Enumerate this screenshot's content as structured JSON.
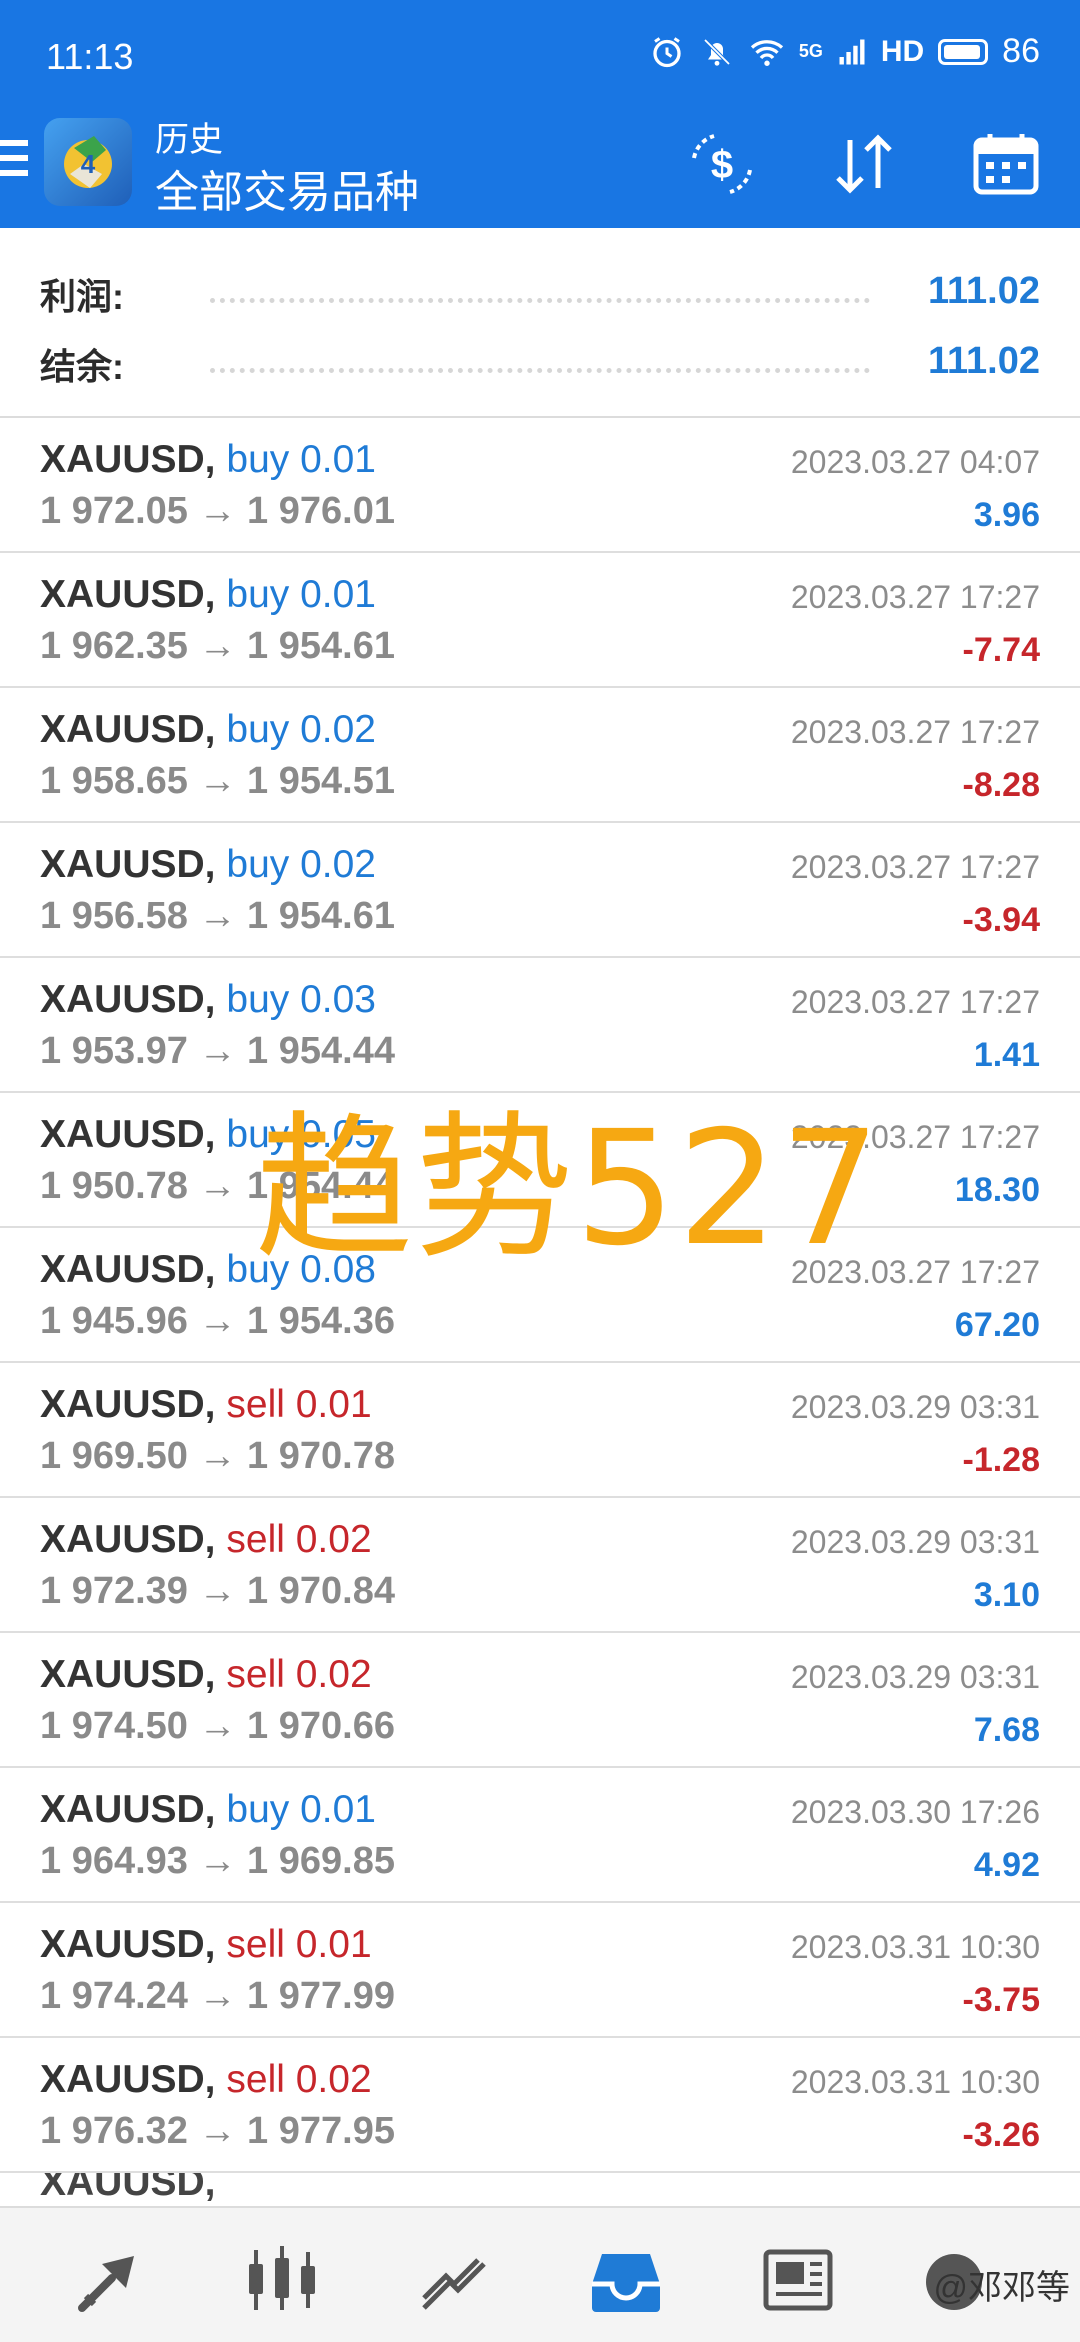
{
  "status": {
    "time": "11:13",
    "network": "5G",
    "hd": "HD",
    "battery": "86"
  },
  "toolbar": {
    "subtitle": "历史",
    "title": "全部交易品种"
  },
  "summary": [
    {
      "label": "利润:",
      "value": "111.02"
    },
    {
      "label": "结余:",
      "value": "111.02"
    }
  ],
  "trades": [
    {
      "symbol": "XAUUSD,",
      "side": "buy",
      "volume": "buy 0.01",
      "open": "1 972.05",
      "close": "1 976.01",
      "time": "2023.03.27 04:07",
      "profit": "3.96"
    },
    {
      "symbol": "XAUUSD,",
      "side": "buy",
      "volume": "buy 0.01",
      "open": "1 962.35",
      "close": "1 954.61",
      "time": "2023.03.27 17:27",
      "profit": "-7.74"
    },
    {
      "symbol": "XAUUSD,",
      "side": "buy",
      "volume": "buy 0.02",
      "open": "1 958.65",
      "close": "1 954.51",
      "time": "2023.03.27 17:27",
      "profit": "-8.28"
    },
    {
      "symbol": "XAUUSD,",
      "side": "buy",
      "volume": "buy 0.02",
      "open": "1 956.58",
      "close": "1 954.61",
      "time": "2023.03.27 17:27",
      "profit": "-3.94"
    },
    {
      "symbol": "XAUUSD,",
      "side": "buy",
      "volume": "buy 0.03",
      "open": "1 953.97",
      "close": "1 954.44",
      "time": "2023.03.27 17:27",
      "profit": "1.41"
    },
    {
      "symbol": "XAUUSD,",
      "side": "buy",
      "volume": "buy 0.05",
      "open": "1 950.78",
      "close": "1 954.44",
      "time": "2023.03.27 17:27",
      "profit": "18.30"
    },
    {
      "symbol": "XAUUSD,",
      "side": "buy",
      "volume": "buy 0.08",
      "open": "1 945.96",
      "close": "1 954.36",
      "time": "2023.03.27 17:27",
      "profit": "67.20"
    },
    {
      "symbol": "XAUUSD,",
      "side": "sell",
      "volume": "sell 0.01",
      "open": "1 969.50",
      "close": "1 970.78",
      "time": "2023.03.29 03:31",
      "profit": "-1.28"
    },
    {
      "symbol": "XAUUSD,",
      "side": "sell",
      "volume": "sell 0.02",
      "open": "1 972.39",
      "close": "1 970.84",
      "time": "2023.03.29 03:31",
      "profit": "3.10"
    },
    {
      "symbol": "XAUUSD,",
      "side": "sell",
      "volume": "sell 0.02",
      "open": "1 974.50",
      "close": "1 970.66",
      "time": "2023.03.29 03:31",
      "profit": "7.68"
    },
    {
      "symbol": "XAUUSD,",
      "side": "buy",
      "volume": "buy 0.01",
      "open": "1 964.93",
      "close": "1 969.85",
      "time": "2023.03.30 17:26",
      "profit": "4.92"
    },
    {
      "symbol": "XAUUSD,",
      "side": "sell",
      "volume": "sell 0.01",
      "open": "1 974.24",
      "close": "1 977.99",
      "time": "2023.03.31 10:30",
      "profit": "-3.75"
    },
    {
      "symbol": "XAUUSD,",
      "side": "sell",
      "volume": "sell 0.02",
      "open": "1 976.32",
      "close": "1 977.95",
      "time": "2023.03.31 10:30",
      "profit": "-3.26"
    }
  ],
  "partial_row": {
    "symbol": "XAUUSD,"
  },
  "arrow": "→",
  "watermark": "趋势527",
  "credit": "@邓邓等",
  "colors": {
    "accent": "#1976e3",
    "positive": "#1f7bd6",
    "negative": "#c6262b",
    "watermark": "#f6a812"
  },
  "bottom_nav": [
    {
      "icon": "quotes-icon"
    },
    {
      "icon": "chart-icon"
    },
    {
      "icon": "trade-icon"
    },
    {
      "icon": "history-icon",
      "active": true
    },
    {
      "icon": "news-icon"
    },
    {
      "icon": "chat-icon"
    }
  ]
}
